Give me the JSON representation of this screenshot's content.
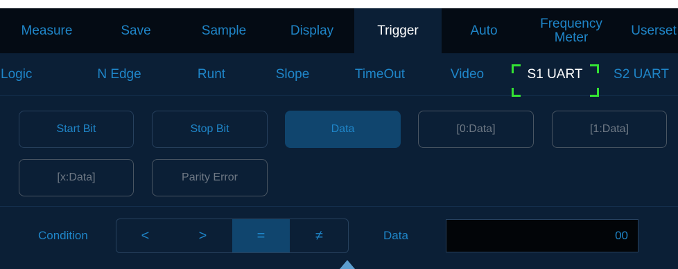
{
  "top_tabs": [
    "Measure",
    "Save",
    "Sample",
    "Display",
    "Trigger",
    "Auto",
    "Frequency Meter",
    "Userset"
  ],
  "active_top_tab": "Trigger",
  "sub_tabs": [
    "Logic",
    "N Edge",
    "Runt",
    "Slope",
    "TimeOut",
    "Video",
    "S1 UART",
    "S2 UART"
  ],
  "selected_sub_tab": "S1 UART",
  "buttons": {
    "start_bit": "Start Bit",
    "stop_bit": "Stop Bit",
    "data": "Data",
    "data0": "[0:Data]",
    "data1": "[1:Data]",
    "datax": "[x:Data]",
    "parity_error": "Parity Error"
  },
  "condition": {
    "label": "Condition",
    "options": [
      "<",
      ">",
      "=",
      "≠"
    ],
    "selected": "="
  },
  "data_field": {
    "label": "Data",
    "value": "00"
  },
  "colors": {
    "accent": "#1f86c9",
    "selection": "#33e233",
    "background": "#0b1f36"
  }
}
